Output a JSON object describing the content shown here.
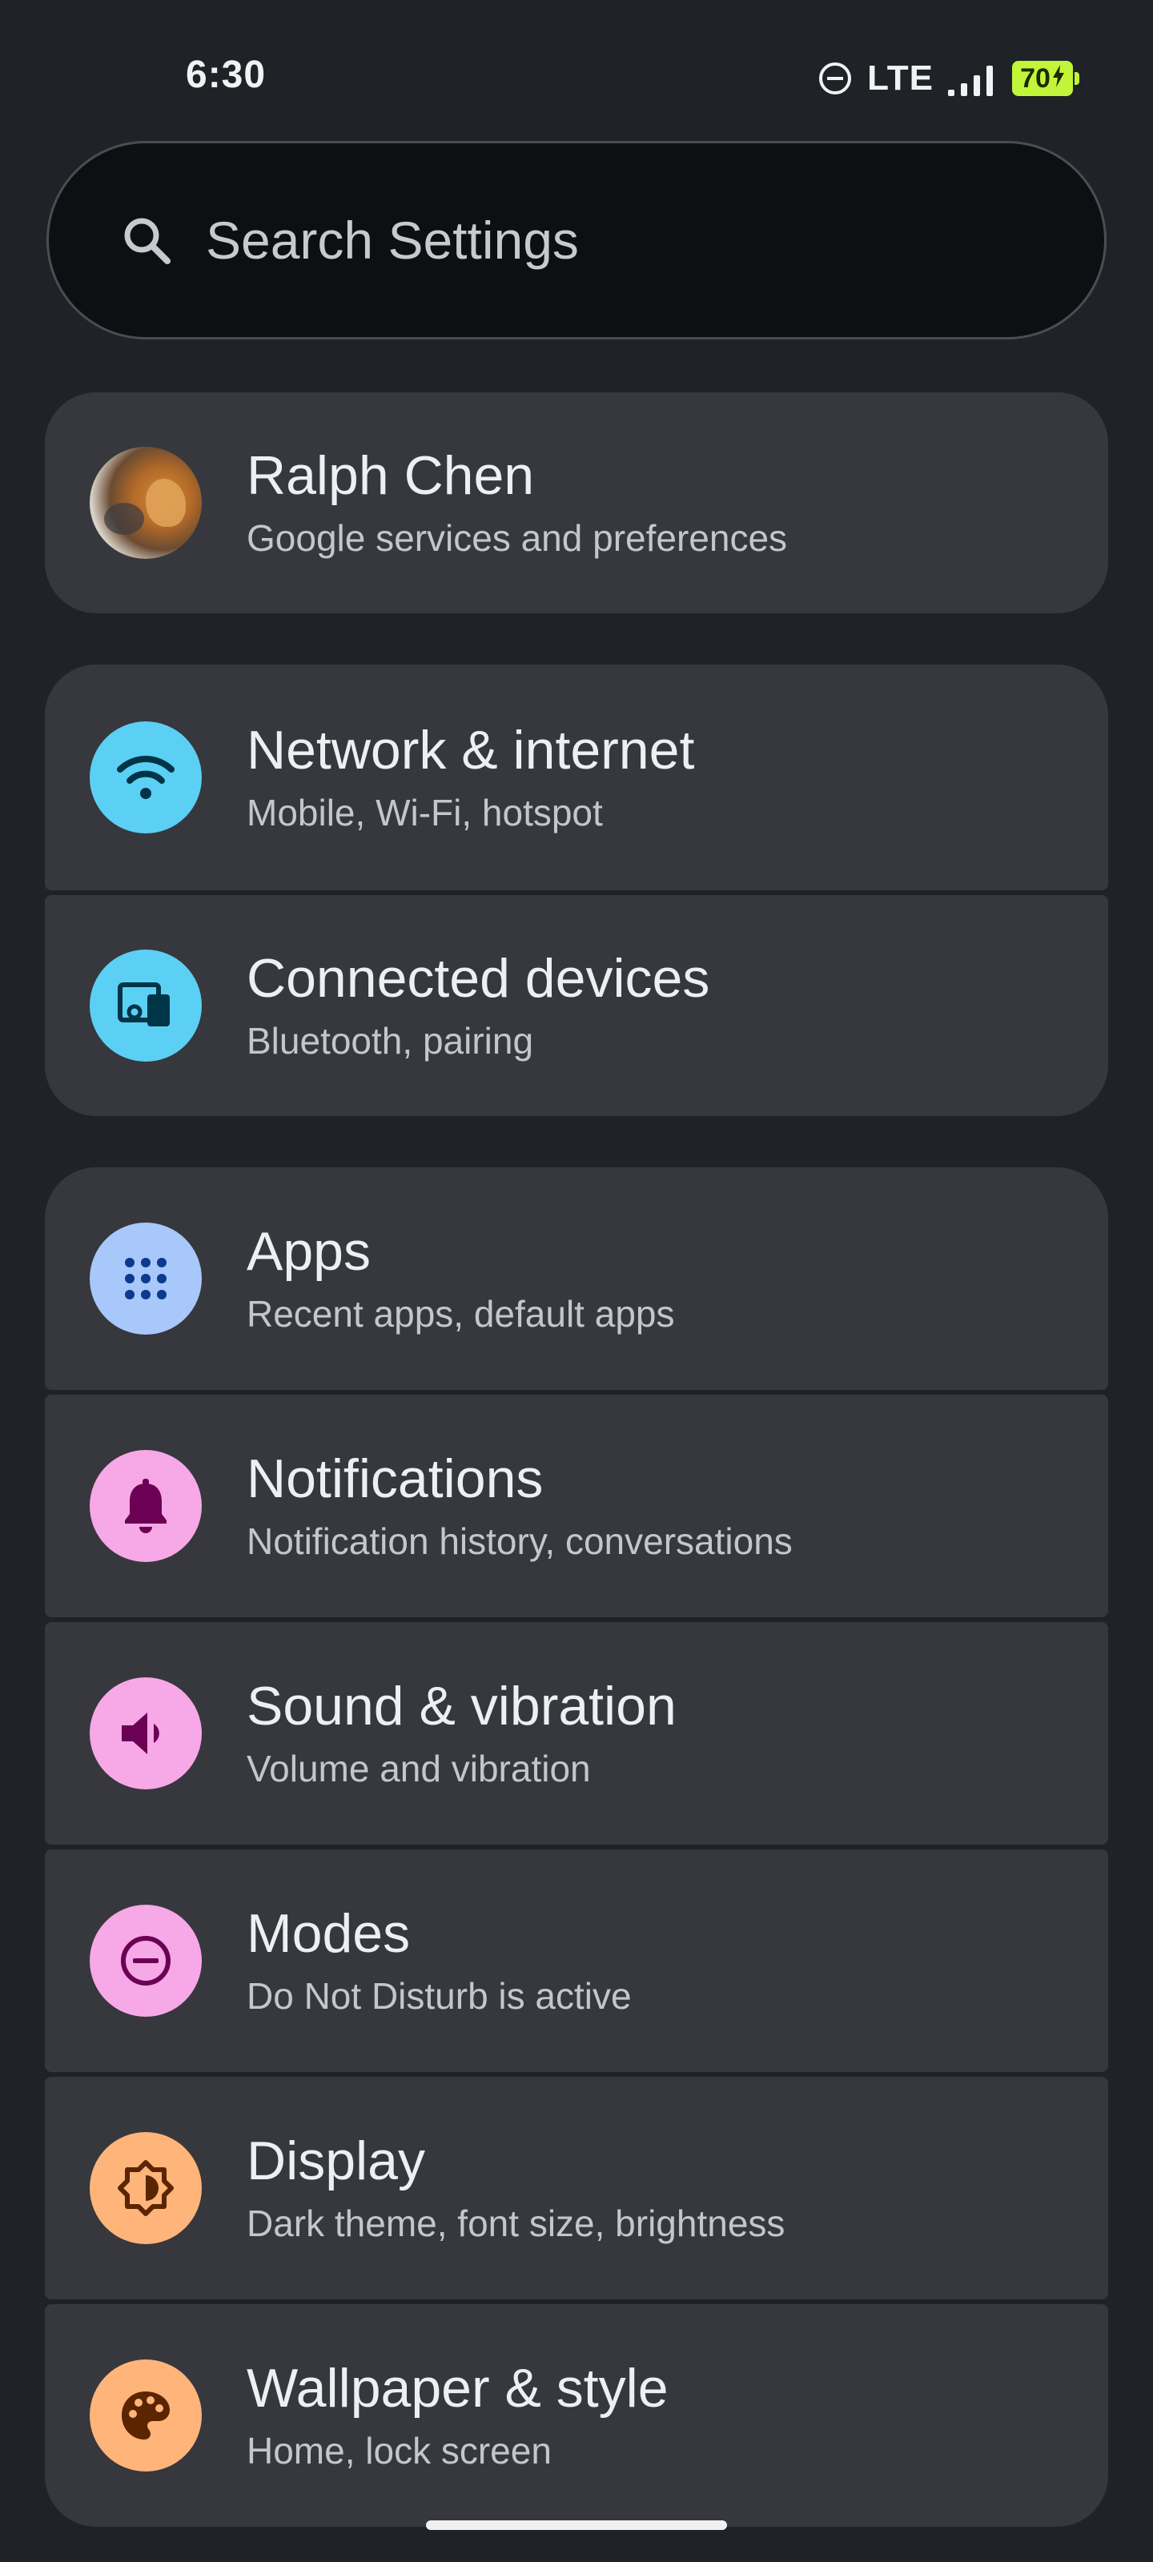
{
  "status_bar": {
    "time": "6:30",
    "network": "LTE",
    "battery": "70",
    "icons": [
      "do-not-disturb-icon",
      "signal-icon",
      "battery-charging-icon"
    ]
  },
  "search": {
    "placeholder": "Search Settings",
    "icon": "search-icon"
  },
  "account": {
    "name": "Ralph Chen",
    "subtitle": "Google services and preferences"
  },
  "items": [
    {
      "title": "Network & internet",
      "subtitle": "Mobile, Wi-Fi, hotspot",
      "icon": "wifi-icon",
      "color": "#5ccff5",
      "icon_color": "#003547"
    },
    {
      "title": "Connected devices",
      "subtitle": "Bluetooth, pairing",
      "icon": "devices-icon",
      "color": "#5ccff5",
      "icon_color": "#003547"
    },
    {
      "title": "Apps",
      "subtitle": "Recent apps, default apps",
      "icon": "apps-grid-icon",
      "color": "#a8c7fa",
      "icon_color": "#0b3a8f"
    },
    {
      "title": "Notifications",
      "subtitle": "Notification history, conversations",
      "icon": "bell-icon",
      "color": "#f7a8e6",
      "icon_color": "#6b0055"
    },
    {
      "title": "Sound & vibration",
      "subtitle": "Volume and vibration",
      "icon": "volume-icon",
      "color": "#f7a8e6",
      "icon_color": "#6b0055"
    },
    {
      "title": "Modes",
      "subtitle": "Do Not Disturb is active",
      "icon": "do-not-disturb-icon",
      "color": "#f7a8e6",
      "icon_color": "#6b0055"
    },
    {
      "title": "Display",
      "subtitle": "Dark theme, font size, brightness",
      "icon": "brightness-icon",
      "color": "#ffb47a",
      "icon_color": "#5a2500"
    },
    {
      "title": "Wallpaper & style",
      "subtitle": "Home, lock screen",
      "icon": "palette-icon",
      "color": "#ffb47a",
      "icon_color": "#5a2500"
    }
  ]
}
